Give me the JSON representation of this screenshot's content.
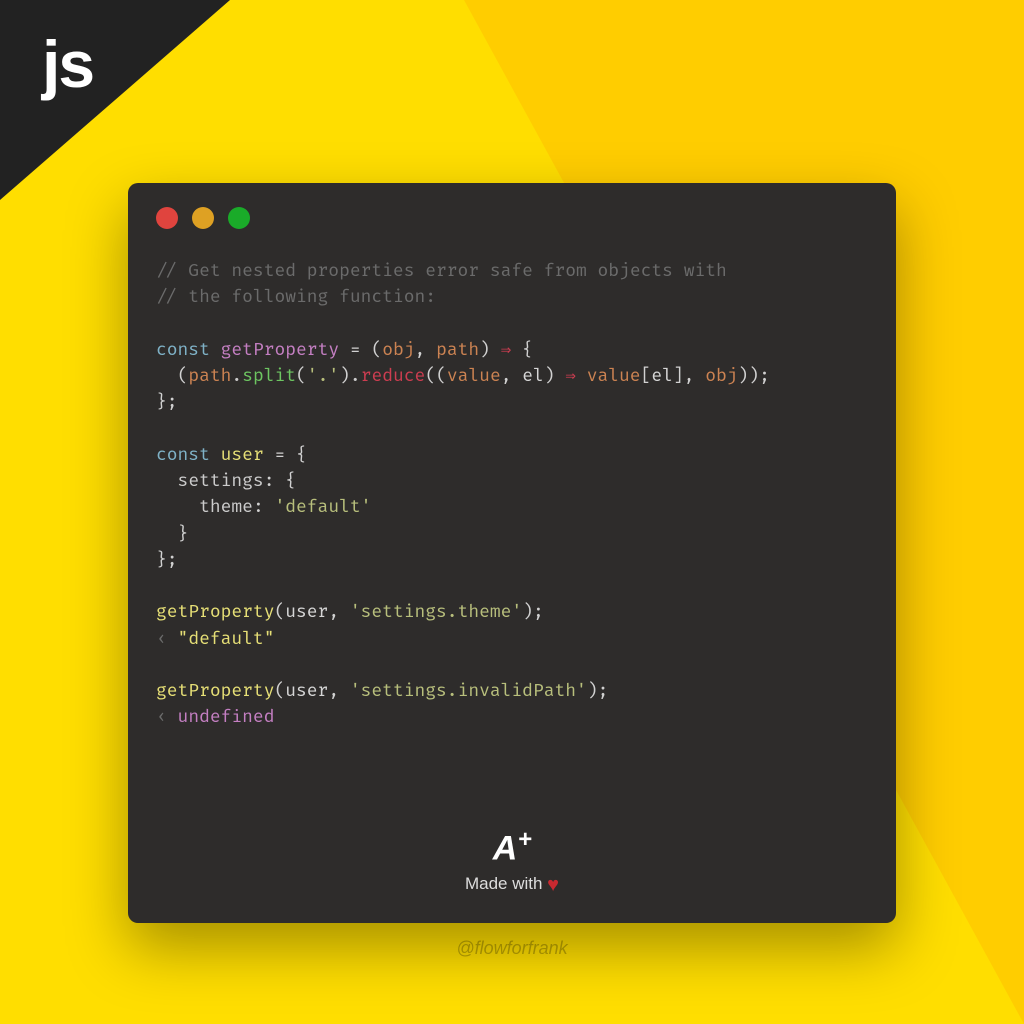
{
  "badge": "js",
  "code": {
    "comment1": "// Get nested properties error safe from objects with",
    "comment2": "// the following function:",
    "kw_const": "const",
    "fn_name": "getProperty",
    "eq": " = ",
    "lp": "(",
    "param_obj": "obj",
    "comma": ", ",
    "param_path": "path",
    "rp": ")",
    "arrow": " ⇒ ",
    "lbrace": "{",
    "indent1": "  ",
    "m_split": "split",
    "dot": ".",
    "str_dot": "'.'",
    "m_reduce": "reduce",
    "lp2": "((",
    "value": "value",
    "el": "el",
    "rp2": ")",
    "arrow2": " ⇒ ",
    "lbr": "[",
    "rbr": "]",
    "rp3": "))",
    "semi": ";",
    "rbrace": "}",
    "const2": "const",
    "user": "user",
    "eq2": " = {",
    "k_settings": "settings",
    "colon": ": {",
    "k_theme": "theme",
    "colon2": ": ",
    "str_default": "'default'",
    "close1": "  }",
    "close2": "};",
    "call1_fn": "getProperty",
    "call1_arg2": "'settings.theme'",
    "ret_arrow": "‹ ",
    "ret1": "\"default\"",
    "call2_arg2": "'settings.invalidPath'",
    "ret2": "undefined",
    "indent2": "    "
  },
  "footer": {
    "logo_a": "A",
    "logo_plus": "+",
    "made": "Made with ",
    "heart": "♥"
  },
  "handle": "@flowforfrank"
}
